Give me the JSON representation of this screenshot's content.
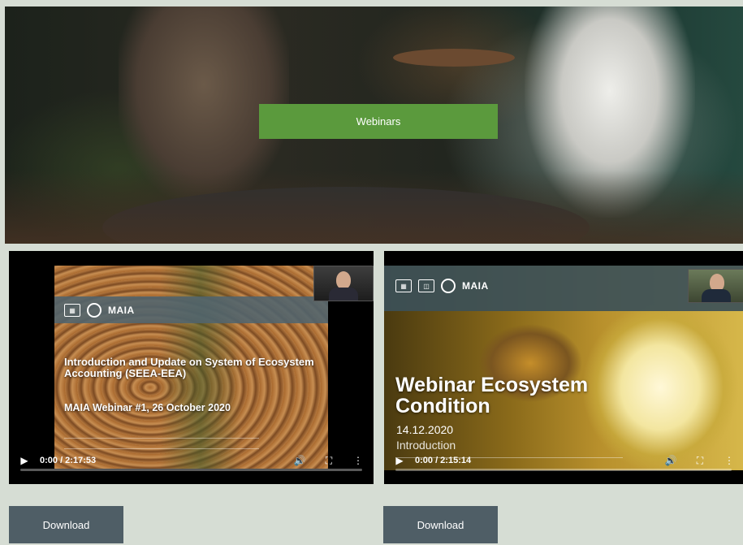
{
  "hero": {
    "button_label": "Webinars"
  },
  "videos": [
    {
      "slide_logo_text": "MAIA",
      "slide_title": "Introduction and Update on System of Ecosystem Accounting (SEEA-EEA)",
      "slide_subtitle": "MAIA Webinar #1, 26 October 2020",
      "time_display": "0:00 / 2:17:53",
      "progress": 0,
      "download_label": "Download"
    },
    {
      "slide_logo_text": "MAIA",
      "slide_title": "Webinar Ecosystem Condition",
      "slide_date": "14.12.2020",
      "slide_subtitle": "Introduction",
      "time_display": "0:00 / 2:15:14",
      "progress": 0,
      "download_label": "Download"
    }
  ],
  "icons": {
    "play": "▶",
    "volume": "🔊",
    "fullscreen": "⛶",
    "more": "⋮"
  },
  "colors": {
    "webinars_button": "#5b9a3d",
    "download_button": "#4f5e66"
  }
}
